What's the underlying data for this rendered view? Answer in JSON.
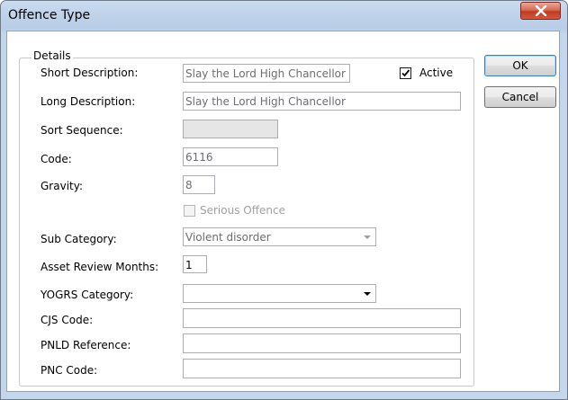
{
  "window": {
    "title": "Offence Type",
    "close_icon": "close-x-icon"
  },
  "group": {
    "legend": "Details"
  },
  "fields": {
    "short_description": {
      "label": "Short Description:",
      "value": "Slay the Lord High Chancellor"
    },
    "active": {
      "label": "Active",
      "checked": true
    },
    "long_description": {
      "label": "Long Description:",
      "value": "Slay the Lord High Chancellor"
    },
    "sort_sequence": {
      "label": "Sort Sequence:",
      "value": ""
    },
    "code": {
      "label": "Code:",
      "value": "6116"
    },
    "gravity": {
      "label": "Gravity:",
      "value": "8"
    },
    "serious_offence": {
      "label": "Serious Offence",
      "checked": false
    },
    "sub_category": {
      "label": "Sub Category:",
      "value": "Violent disorder"
    },
    "asset_review_months": {
      "label": "Asset Review Months:",
      "value": "1"
    },
    "yogrs_category": {
      "label": "YOGRS Category:",
      "value": ""
    },
    "cjs_code": {
      "label": "CJS Code:",
      "value": ""
    },
    "pnld_reference": {
      "label": "PNLD Reference:",
      "value": ""
    },
    "pnc_code": {
      "label": "PNC Code:",
      "value": ""
    }
  },
  "buttons": {
    "ok": "OK",
    "cancel": "Cancel"
  },
  "colors": {
    "close_button": "#c23b22",
    "titlebar": "#bfd3ea",
    "default_button_border": "#3c7fb1"
  }
}
